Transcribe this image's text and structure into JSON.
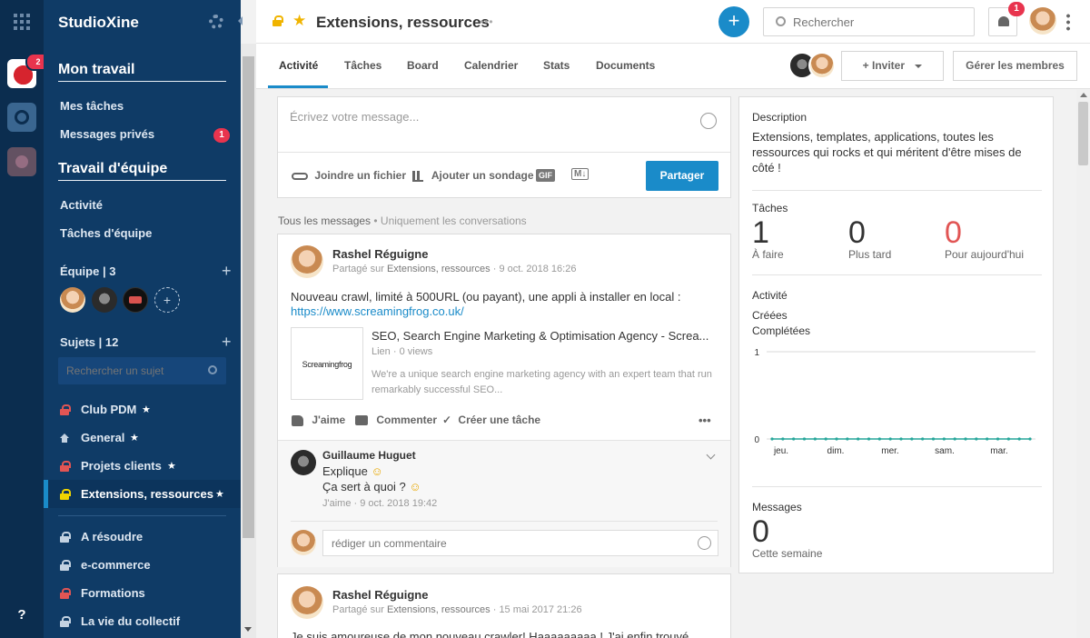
{
  "app": {
    "name": "StudioXine",
    "help": "?"
  },
  "rail": {
    "badge": "2"
  },
  "sidebar": {
    "my_work": "Mon travail",
    "my_tasks": "Mes tâches",
    "private_messages": "Messages privés",
    "private_badge": "1",
    "team_work": "Travail d'équipe",
    "activity": "Activité",
    "team_tasks": "Tâches d'équipe",
    "team_label": "Équipe | 3",
    "subjects_label": "Sujets | 12",
    "subject_search_placeholder": "Rechercher un sujet",
    "subjects": [
      {
        "name": "Club PDM",
        "star": "★"
      },
      {
        "name": "General",
        "star": "★"
      },
      {
        "name": "Projets clients",
        "star": "★"
      },
      {
        "name": "Extensions, ressources",
        "star": "★"
      },
      {
        "name": "A résoudre",
        "star": ""
      },
      {
        "name": "e-commerce",
        "star": ""
      },
      {
        "name": "Formations",
        "star": ""
      },
      {
        "name": "La vie du collectif",
        "star": ""
      }
    ]
  },
  "header": {
    "title": "Extensions, ressources",
    "more": "•••",
    "add": "+",
    "search_placeholder": "Rechercher",
    "notif_badge": "1"
  },
  "tabs": [
    "Activité",
    "Tâches",
    "Board",
    "Calendrier",
    "Stats",
    "Documents"
  ],
  "members": {
    "invite": "Inviter",
    "manage": "Gérer les membres"
  },
  "composer": {
    "placeholder": "Écrivez votre message...",
    "attach": "Joindre un fichier",
    "poll": "Ajouter un sondage",
    "gif": "GIF",
    "md": "M↓",
    "share": "Partager"
  },
  "filter": {
    "all": "Tous les messages",
    "sep": " • ",
    "conversations": "Uniquement les conversations"
  },
  "post1": {
    "author": "Rashel Réguigne",
    "shared_on": "Partagé sur",
    "subject": "Extensions, ressources",
    "date": "9 oct. 2018 16:26",
    "text": "Nouveau crawl, limité à 500URL (ou payant), une appli à installer en local :",
    "url": "https://www.screamingfrog.co.uk/",
    "preview": {
      "logo": "Screamingfrog",
      "title": "SEO, Search Engine Marketing & Optimisation Agency - Screa...",
      "meta": "Lien · 0 views",
      "desc": "We're a unique search engine marketing agency with an expert team that run remarkably successful SEO..."
    },
    "like": "J'aime",
    "comment": "Commenter",
    "task": "Créer une tâche",
    "more": "•••"
  },
  "reply": {
    "author": "Guillaume Huguet",
    "line1": "Explique",
    "line2": "Ça sert à quoi ?",
    "emoji": "☺",
    "meta": "J'aime · 9 oct. 2018 19:42",
    "comment_placeholder": "rédiger un commentaire"
  },
  "post2": {
    "author": "Rashel Réguigne",
    "shared_on": "Partagé sur",
    "subject": "Extensions, ressources",
    "date": "15 mai 2017 21:26",
    "text": "Je suis amoureuse de mon nouveau crawler! Haaaaaaaaa ! J'ai enfin trouvé"
  },
  "panel": {
    "desc_title": "Description",
    "desc": "Extensions, templates, applications, toutes les ressources qui rocks et qui méritent d'être mises de côté !",
    "tasks_title": "Tâches",
    "task_stats": [
      {
        "value": "1",
        "label": "À faire"
      },
      {
        "value": "0",
        "label": "Plus tard"
      },
      {
        "value": "0",
        "label": "Pour aujourd'hui"
      }
    ],
    "activity_title": "Activité",
    "legend_created": "Créées",
    "legend_completed": "Complétées",
    "messages_title": "Messages",
    "messages_value": "0",
    "messages_label": "Cette semaine"
  },
  "chart_data": {
    "type": "line",
    "x": [
      "jeu.",
      "dim.",
      "mer.",
      "sam.",
      "mar."
    ],
    "y_ticks": [
      "1",
      "0"
    ],
    "ylim": [
      0,
      1
    ],
    "series": [
      {
        "name": "Créées",
        "values": [
          0,
          0,
          0,
          0,
          0
        ]
      },
      {
        "name": "Complétées",
        "values": [
          0,
          0,
          0,
          0,
          0
        ]
      }
    ],
    "color": "#26a69a"
  },
  "colors": {
    "sidebar": "#0f3b66",
    "rail": "#0b2d4f",
    "accent": "#1a8bc9",
    "badge": "#e8344e",
    "star": "#f0b400",
    "red": "#e15554"
  }
}
